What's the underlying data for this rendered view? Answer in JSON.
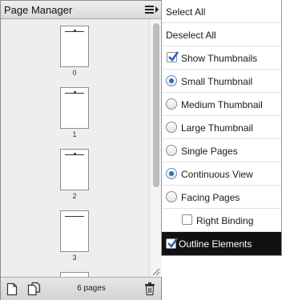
{
  "panel": {
    "title": "Page Manager",
    "page_count": "6 pages",
    "thumbnails": [
      {
        "label": "0"
      },
      {
        "label": "1"
      },
      {
        "label": "2"
      },
      {
        "label": "3"
      }
    ]
  },
  "icons": {
    "menu": "hamburger-menu-icon",
    "new_page": "new-page-icon",
    "duplicate": "duplicate-page-icon",
    "delete": "trash-icon",
    "resize": "resize-grip-icon"
  },
  "menu": {
    "select_all": "Select All",
    "deselect_all": "Deselect All",
    "show_thumbnails": {
      "label": "Show Thumbnails",
      "checked": true
    },
    "thumbnail_size": {
      "options": [
        "Small Thumbnail",
        "Medium Thumbnail",
        "Large Thumbnail"
      ],
      "selected": "Small Thumbnail"
    },
    "page_layout": {
      "options": [
        "Single Pages",
        "Continuous View",
        "Facing Pages"
      ],
      "selected": "Continuous View"
    },
    "right_binding": {
      "label": "Right Binding",
      "checked": false
    },
    "outline_elements": {
      "label": "Outline Elements",
      "checked": true
    }
  },
  "colors": {
    "accent": "#2f6db3",
    "highlight_row": "#111111"
  }
}
